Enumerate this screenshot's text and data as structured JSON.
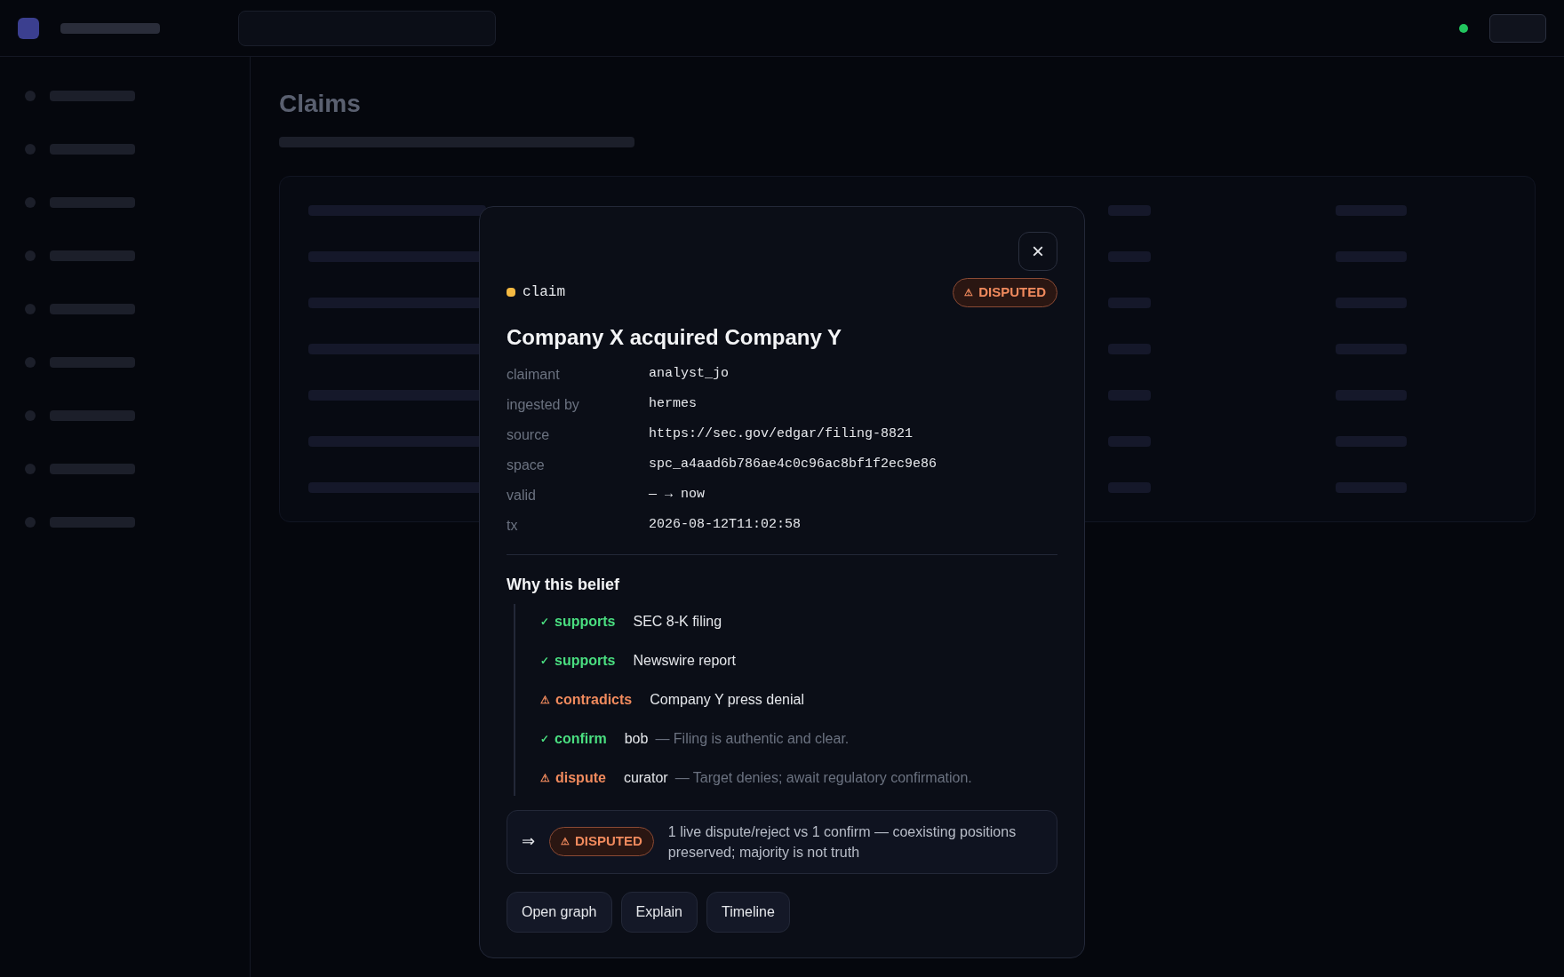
{
  "page": {
    "title": "Claims"
  },
  "dialog": {
    "close_icon": "×",
    "type_label": "claim",
    "status": {
      "icon": "⚠",
      "label": "DISPUTED"
    },
    "title": "Company X acquired Company Y",
    "fields": [
      {
        "label": "claimant",
        "value": "analyst_jo"
      },
      {
        "label": "ingested by",
        "value": "hermes"
      },
      {
        "label": "source",
        "value": "https://sec.gov/edgar/filing-8821"
      },
      {
        "label": "space",
        "value": "spc_a4aad6b786ae4c0c96ac8bf1f2ec9e86"
      },
      {
        "label": "valid",
        "value": "— → now"
      },
      {
        "label": "tx",
        "value": "2026-08-12T11:02:58"
      }
    ],
    "evidence_heading": "Why this belief",
    "evidence": [
      {
        "kind": "pro",
        "icon": "✓",
        "relation": "supports",
        "subject": "SEC 8-K filing"
      },
      {
        "kind": "pro",
        "icon": "✓",
        "relation": "supports",
        "subject": "Newswire report"
      },
      {
        "kind": "con",
        "icon": "⚠",
        "relation": "contradicts",
        "subject": "Company Y press denial"
      },
      {
        "kind": "pro",
        "icon": "✓",
        "relation": "confirm",
        "subject": "bob",
        "note": "— Filing is authentic and clear."
      },
      {
        "kind": "con",
        "icon": "⚠",
        "relation": "dispute",
        "subject": "curator",
        "note": "— Target denies; await regulatory confirmation."
      }
    ],
    "verdict": {
      "arrow": "⇒",
      "status": {
        "icon": "⚠",
        "label": "DISPUTED"
      },
      "text": "1 live dispute/reject vs 1 confirm — coexisting positions preserved; majority is not truth"
    },
    "actions": [
      "Open graph",
      "Explain",
      "Timeline"
    ]
  }
}
